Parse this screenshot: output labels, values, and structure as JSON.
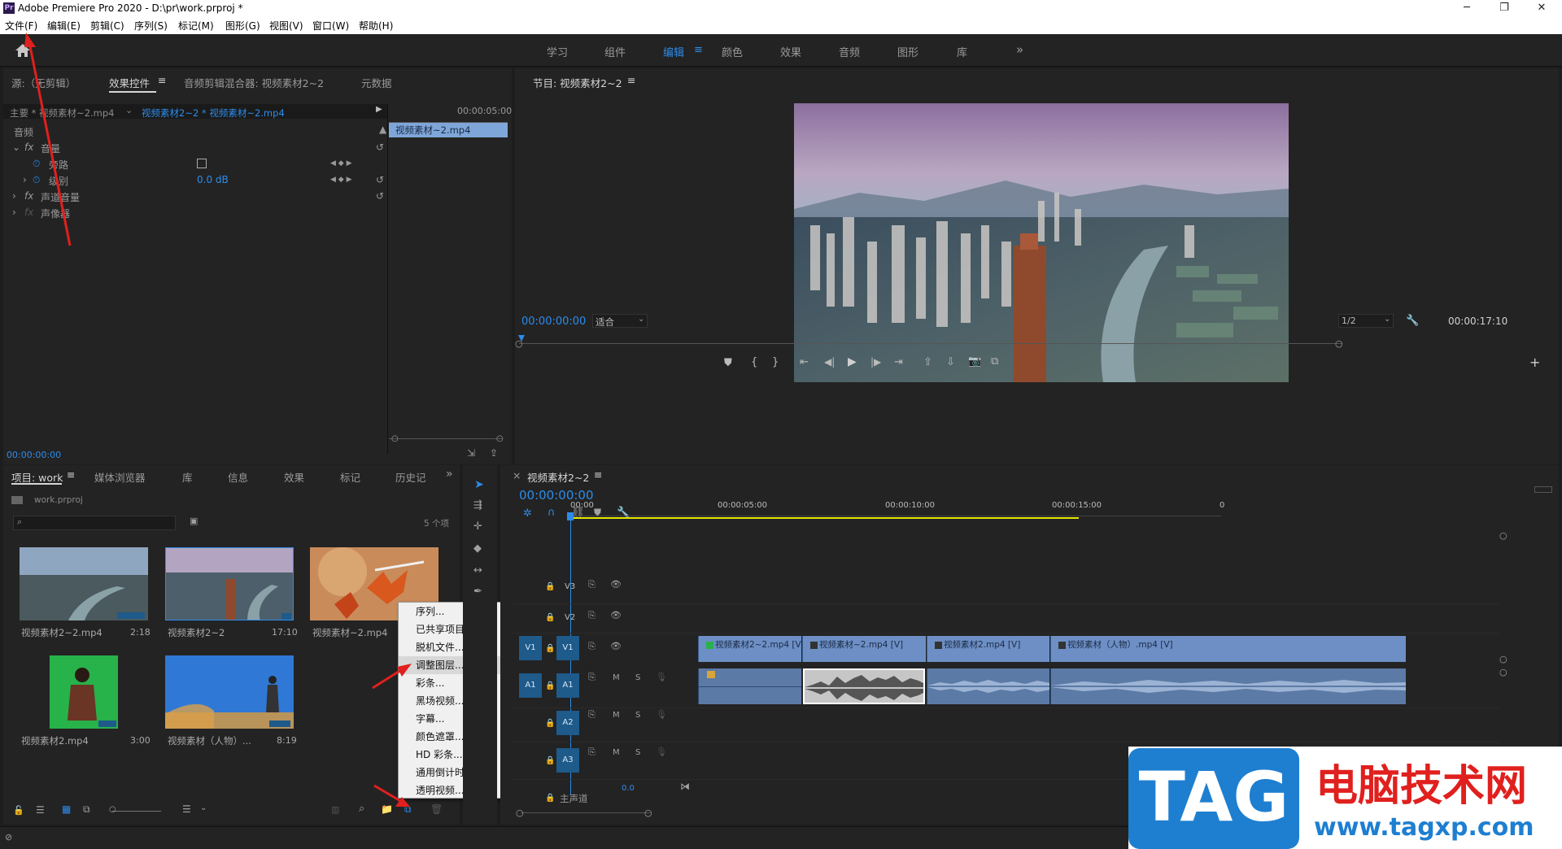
{
  "window": {
    "app_icon": "Pr",
    "title": "Adobe Premiere Pro 2020 - D:\\pr\\work.prproj *"
  },
  "menubar": [
    "文件(F)",
    "编辑(E)",
    "剪辑(C)",
    "序列(S)",
    "标记(M)",
    "图形(G)",
    "视图(V)",
    "窗口(W)",
    "帮助(H)"
  ],
  "workspaces": {
    "items": [
      "学习",
      "组件",
      "编辑",
      "颜色",
      "效果",
      "音频",
      "图形",
      "库"
    ],
    "active": "编辑"
  },
  "source_panel": {
    "tabs": [
      "源:（无剪辑）",
      "效果控件",
      "音频剪辑混合器: 视频素材2~2",
      "元数据"
    ],
    "master_label": "主要 * 视频素材~2.mp4",
    "clip_label": "视频素材2~2 * 视频素材~2.mp4",
    "timecode_right": "00:00:05:00",
    "clip_bar_label": "视频素材~2.mp4",
    "section": "音频",
    "rows": [
      {
        "label": "音量",
        "fx": true,
        "reset": true
      },
      {
        "label": "旁路",
        "value": "",
        "checkbox": true
      },
      {
        "label": "级别",
        "value": "0.0 dB",
        "reset": true
      },
      {
        "label": "声道音量",
        "fx": true,
        "reset": true
      },
      {
        "label": "声像器",
        "fx": true
      }
    ],
    "timecode_bottom": "00:00:00:00"
  },
  "program": {
    "title": "节目: 视频素材2~2",
    "timecode": "00:00:00:00",
    "fit": "适合",
    "resolution": "1/2",
    "duration": "00:00:17:10"
  },
  "project": {
    "tabs": [
      "项目: work",
      "媒体浏览器",
      "库",
      "信息",
      "效果",
      "标记",
      "历史记"
    ],
    "file": "work.prproj",
    "count": "5 个项",
    "items": [
      {
        "name": "视频素材2~2.mp4",
        "duration": "2:18"
      },
      {
        "name": "视频素材2~2",
        "duration": "17:10"
      },
      {
        "name": "视频素材~2.mp4",
        "duration": ""
      },
      {
        "name": "视频素材2.mp4",
        "duration": "3:00"
      },
      {
        "name": "视频素材（人物）...",
        "duration": "8:19"
      }
    ]
  },
  "context_menu": {
    "items": [
      "序列...",
      "已共享项目...",
      "脱机文件...",
      "调整图层...",
      "彩条...",
      "黑场视频...",
      "字幕...",
      "颜色遮罩...",
      "HD 彩条...",
      "通用倒计时片头...",
      "透明视频..."
    ],
    "highlighted": "调整图层..."
  },
  "timeline": {
    "title": "视频素材2~2",
    "timecode": "00:00:00:00",
    "ruler": [
      "00:00",
      "00:00:05:00",
      "00:00:10:00",
      "00:00:15:00",
      "0"
    ],
    "tracks": {
      "video": [
        "V3",
        "V2",
        "V1"
      ],
      "audio": [
        "A1",
        "A2",
        "A3"
      ],
      "source_v": "V1",
      "source_a": "A1",
      "master": "主声道",
      "master_value": "0.0"
    },
    "clips": [
      "视频素材2~2.mp4 [V]",
      "视频素材~2.mp4 [V]",
      "视频素材2.mp4 [V]",
      "视频素材（人物）.mp4 [V]"
    ],
    "toggles": [
      "M",
      "S"
    ]
  },
  "watermark": {
    "logo": "TAG",
    "title": "电脑技术网",
    "url": "www.tagxp.com"
  }
}
